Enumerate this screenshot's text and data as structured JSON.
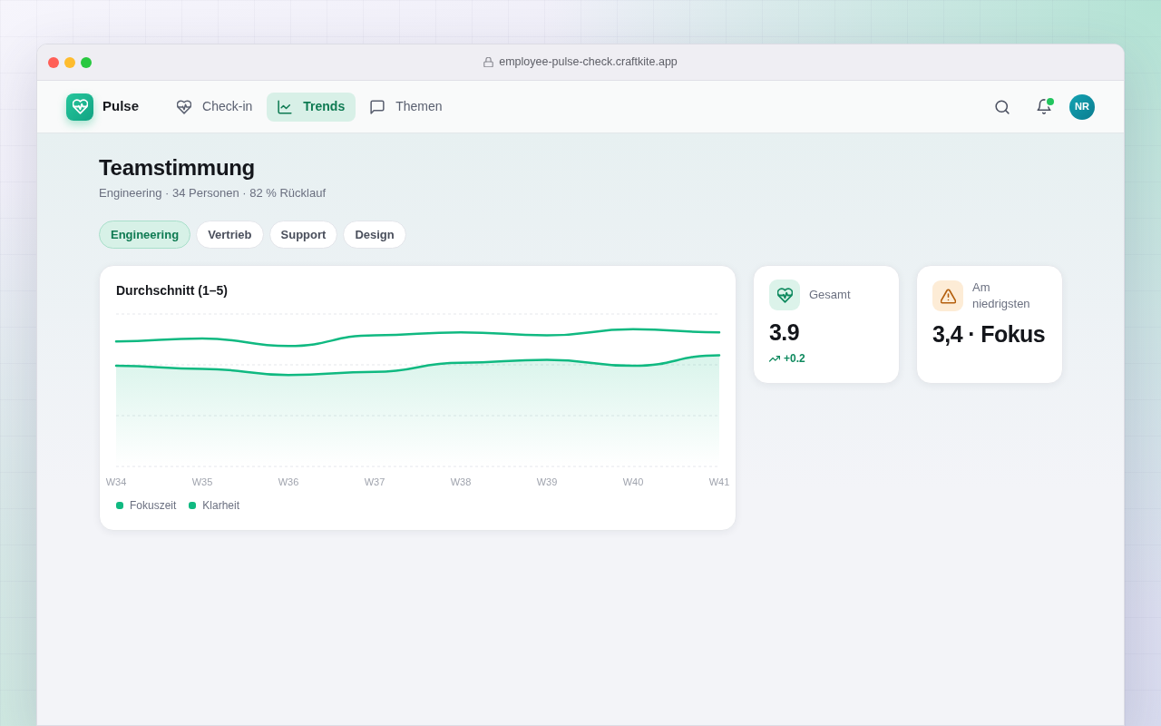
{
  "browser": {
    "url": "employee-pulse-check.craftkite.app"
  },
  "app": {
    "name": "Pulse"
  },
  "nav": [
    {
      "label": "Check-in",
      "selected": false
    },
    {
      "label": "Trends",
      "selected": true
    },
    {
      "label": "Themen",
      "selected": false
    }
  ],
  "toolbar": {
    "notifications_unread": true,
    "avatar_initials": "NR"
  },
  "page": {
    "title": "Teamstimmung",
    "subtitle": "Engineering · 34 Personen · 82 % Rücklauf"
  },
  "filters": [
    {
      "label": "Engineering",
      "selected": true
    },
    {
      "label": "Vertrieb",
      "selected": false
    },
    {
      "label": "Support",
      "selected": false
    },
    {
      "label": "Design",
      "selected": false
    }
  ],
  "chart_card": {
    "title": "Durchschnitt (1–5)",
    "x_labels": [
      "W34",
      "W35",
      "W36",
      "W37",
      "W38",
      "W39",
      "W40",
      "W41"
    ],
    "series": [
      {
        "name": "Fokuszeit",
        "color": "#10b981"
      },
      {
        "name": "Klarheit",
        "color": "#10b981"
      }
    ]
  },
  "stats": [
    {
      "kind": "trend",
      "label": "Gesamt",
      "value": "3.9",
      "change": "+0.2"
    },
    {
      "kind": "alert",
      "label": "Am niedrigsten",
      "value": "3,4 · Fokus"
    }
  ]
}
